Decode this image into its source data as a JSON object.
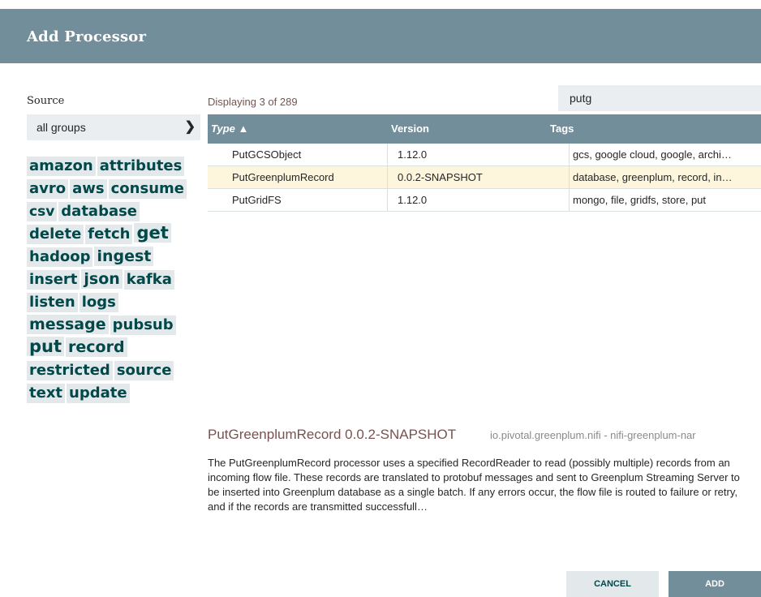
{
  "dialog": {
    "title": "Add Processor"
  },
  "source": {
    "label": "Source",
    "selected_group": "all groups"
  },
  "tags": [
    {
      "label": "amazon",
      "size": 18
    },
    {
      "label": "attributes",
      "size": 18
    },
    {
      "label": "avro",
      "size": 18
    },
    {
      "label": "aws",
      "size": 18
    },
    {
      "label": "consume",
      "size": 18
    },
    {
      "label": "csv",
      "size": 17
    },
    {
      "label": "database",
      "size": 18
    },
    {
      "label": "delete",
      "size": 18
    },
    {
      "label": "fetch",
      "size": 18
    },
    {
      "label": "get",
      "size": 21
    },
    {
      "label": "hadoop",
      "size": 18
    },
    {
      "label": "ingest",
      "size": 19
    },
    {
      "label": "insert",
      "size": 18
    },
    {
      "label": "json",
      "size": 19
    },
    {
      "label": "kafka",
      "size": 18
    },
    {
      "label": "listen",
      "size": 18
    },
    {
      "label": "logs",
      "size": 18
    },
    {
      "label": "message",
      "size": 19
    },
    {
      "label": "pubsub",
      "size": 18
    },
    {
      "label": "put",
      "size": 21
    },
    {
      "label": "record",
      "size": 19
    },
    {
      "label": "restricted",
      "size": 18
    },
    {
      "label": "source",
      "size": 18
    },
    {
      "label": "text",
      "size": 18
    },
    {
      "label": "update",
      "size": 18
    }
  ],
  "results": {
    "count_text": "Displaying 3 of 289"
  },
  "search": {
    "value": "putg"
  },
  "table": {
    "headers": {
      "type": "Type ▲",
      "version": "Version",
      "tags": "Tags"
    },
    "rows": [
      {
        "type": "PutGCSObject",
        "version": "1.12.0",
        "tags": "gcs, google cloud, google, archi…",
        "selected": false
      },
      {
        "type": "PutGreenplumRecord",
        "version": "0.0.2-SNAPSHOT",
        "tags": "database, greenplum, record, in…",
        "selected": true
      },
      {
        "type": "PutGridFS",
        "version": "1.12.0",
        "tags": "mongo, file, gridfs, store, put",
        "selected": false
      }
    ]
  },
  "detail": {
    "name": "PutGreenplumRecord 0.0.2-SNAPSHOT",
    "bundle": "io.pivotal.greenplum.nifi - nifi-greenplum-nar",
    "description": "The PutGreenplumRecord processor uses a specified RecordReader to read (possibly multiple) records from an incoming flow file. These records are translated to protobuf messages and sent to Greenplum Streaming Server to be inserted into Greenplum database as a single batch. If any errors occur, the flow file is routed to failure or retry, and if the records are transmitted successfull…"
  },
  "buttons": {
    "cancel": "CANCEL",
    "add": "ADD"
  },
  "colors": {
    "header_bg": "#728e9b",
    "tag_text": "#004849",
    "tag_bg": "#e3e8eb",
    "selected_row": "#fdf6dd",
    "accent_text": "#775351"
  },
  "icons": {
    "select_chevron": "chevron-down-icon"
  }
}
